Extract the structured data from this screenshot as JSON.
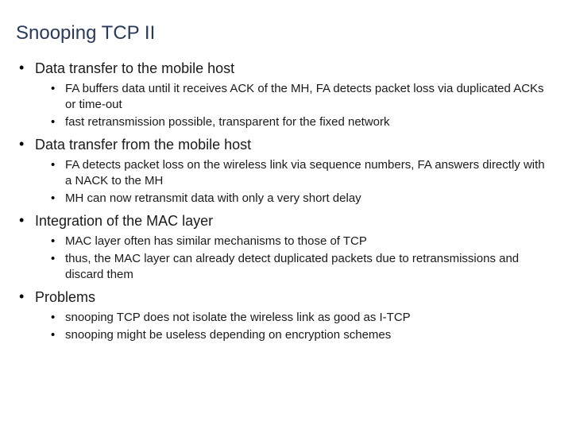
{
  "title": "Snooping TCP II",
  "sections": [
    {
      "heading": "Data transfer to the mobile host",
      "items": [
        "FA buffers data until it receives ACK of the MH, FA detects packet loss via duplicated ACKs or time-out",
        "fast retransmission possible, transparent for the fixed network"
      ]
    },
    {
      "heading": "Data transfer from the mobile host",
      "items": [
        "FA detects packet loss on the wireless link via sequence numbers, FA answers directly with a NACK to the MH",
        "MH can now retransmit data with only a very short delay"
      ]
    },
    {
      "heading": "Integration of the MAC layer",
      "items": [
        "MAC layer often has similar mechanisms to those of TCP",
        "thus, the MAC layer can already detect duplicated packets due to retransmissions and discard them"
      ]
    },
    {
      "heading": "Problems",
      "items": [
        "snooping TCP does not isolate the wireless link as good as I-TCP",
        "snooping might be useless depending on encryption schemes"
      ]
    }
  ]
}
